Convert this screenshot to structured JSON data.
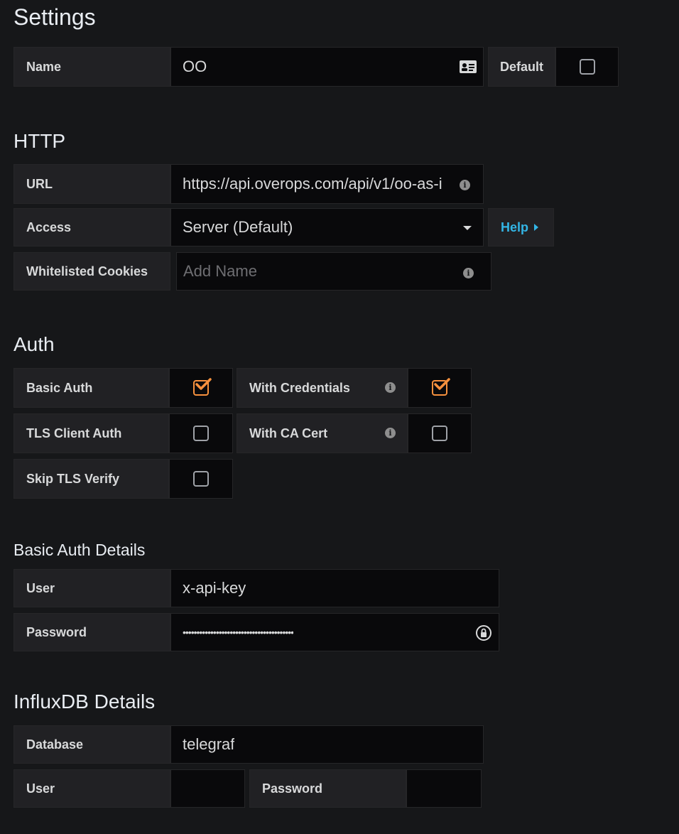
{
  "settings": {
    "title": "Settings",
    "name_label": "Name",
    "name_value": "OO",
    "default_label": "Default",
    "default_checked": false
  },
  "http": {
    "title": "HTTP",
    "url_label": "URL",
    "url_value": "https://api.overops.com/api/v1/oo-as-i",
    "access_label": "Access",
    "access_value": "Server (Default)",
    "help_label": "Help",
    "cookies_label": "Whitelisted Cookies",
    "cookies_placeholder": "Add Name"
  },
  "auth": {
    "title": "Auth",
    "basic_auth_label": "Basic Auth",
    "basic_auth_checked": true,
    "with_credentials_label": "With Credentials",
    "with_credentials_checked": true,
    "tls_client_auth_label": "TLS Client Auth",
    "tls_client_auth_checked": false,
    "with_ca_cert_label": "With CA Cert",
    "with_ca_cert_checked": false,
    "skip_tls_label": "Skip TLS Verify",
    "skip_tls_checked": false
  },
  "basic_auth_details": {
    "title": "Basic Auth Details",
    "user_label": "User",
    "user_value": "x-api-key",
    "password_label": "Password",
    "password_value": "••••••••••••••••••••••••••••••••••••••••"
  },
  "influxdb": {
    "title": "InfluxDB Details",
    "database_label": "Database",
    "database_value": "telegraf",
    "user_label": "User",
    "user_value": "",
    "password_label": "Password",
    "password_value": ""
  },
  "colors": {
    "accent_orange": "#f7913e",
    "link_blue": "#33b5e5",
    "background": "#161719"
  },
  "icons": {
    "name_field": "id-card-icon",
    "info": "info-icon",
    "dropdown": "caret-down-icon",
    "help": "caret-right-icon",
    "password_field": "lock-icon"
  }
}
